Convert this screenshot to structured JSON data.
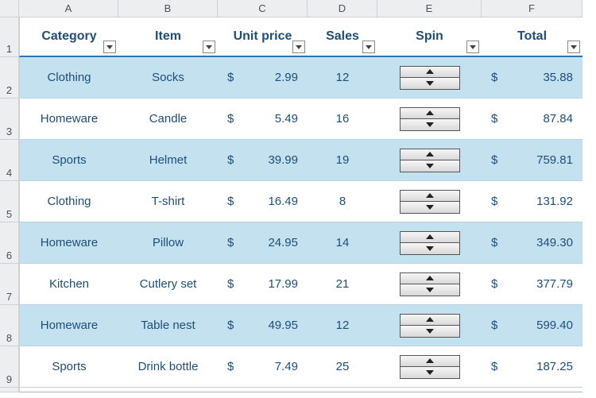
{
  "columns": [
    "A",
    "B",
    "C",
    "D",
    "E",
    "F"
  ],
  "rowNumbers": [
    "1",
    "2",
    "3",
    "4",
    "5",
    "6",
    "7",
    "8",
    "9"
  ],
  "headers": {
    "category": "Category",
    "item": "Item",
    "unit_price": "Unit price",
    "sales": "Sales",
    "spin": "Spin",
    "total": "Total"
  },
  "currency": "$",
  "rows": [
    {
      "category": "Clothing",
      "item": "Socks",
      "unit_price": "2.99",
      "sales": "12",
      "total": "35.88"
    },
    {
      "category": "Homeware",
      "item": "Candle",
      "unit_price": "5.49",
      "sales": "16",
      "total": "87.84"
    },
    {
      "category": "Sports",
      "item": "Helmet",
      "unit_price": "39.99",
      "sales": "19",
      "total": "759.81"
    },
    {
      "category": "Clothing",
      "item": "T-shirt",
      "unit_price": "16.49",
      "sales": "8",
      "total": "131.92"
    },
    {
      "category": "Homeware",
      "item": "Pillow",
      "unit_price": "24.95",
      "sales": "14",
      "total": "349.30"
    },
    {
      "category": "Kitchen",
      "item": "Cutlery set",
      "unit_price": "17.99",
      "sales": "21",
      "total": "377.79"
    },
    {
      "category": "Homeware",
      "item": "Table nest",
      "unit_price": "49.95",
      "sales": "12",
      "total": "599.40"
    },
    {
      "category": "Sports",
      "item": "Drink bottle",
      "unit_price": "7.49",
      "sales": "25",
      "total": "187.25"
    }
  ],
  "chart_data": {
    "type": "table",
    "title": "",
    "columns": [
      "Category",
      "Item",
      "Unit price",
      "Sales",
      "Spin",
      "Total"
    ],
    "rows": [
      [
        "Clothing",
        "Socks",
        2.99,
        12,
        null,
        35.88
      ],
      [
        "Homeware",
        "Candle",
        5.49,
        16,
        null,
        87.84
      ],
      [
        "Sports",
        "Helmet",
        39.99,
        19,
        null,
        759.81
      ],
      [
        "Clothing",
        "T-shirt",
        16.49,
        8,
        null,
        131.92
      ],
      [
        "Homeware",
        "Pillow",
        24.95,
        14,
        null,
        349.3
      ],
      [
        "Kitchen",
        "Cutlery set",
        17.99,
        21,
        null,
        377.79
      ],
      [
        "Homeware",
        "Table nest",
        49.95,
        12,
        null,
        599.4
      ],
      [
        "Sports",
        "Drink bottle",
        7.49,
        25,
        null,
        187.25
      ]
    ]
  }
}
